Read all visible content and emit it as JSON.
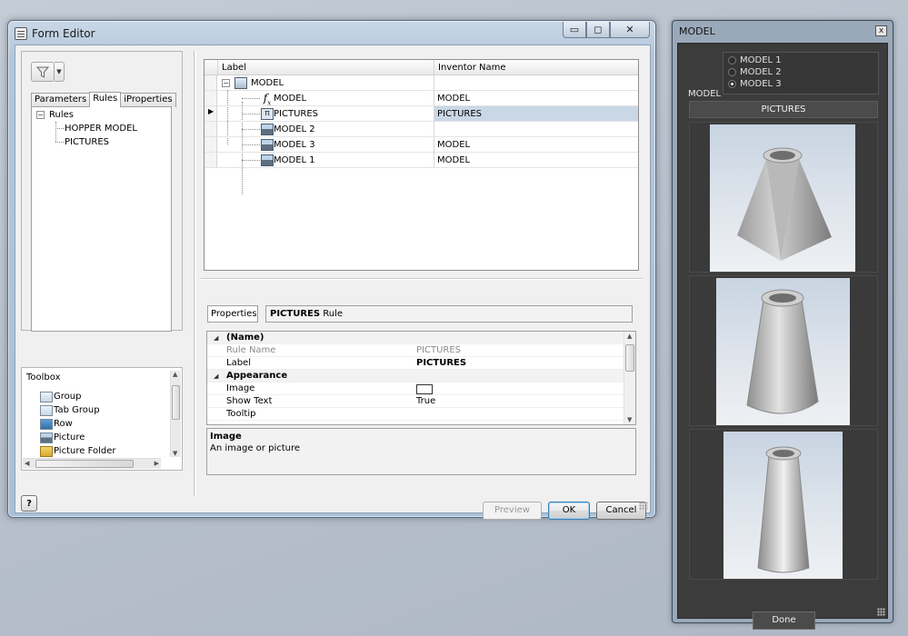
{
  "form_editor": {
    "title": "Form Editor",
    "caption_buttons": {
      "minimize": "▭",
      "maximize": "◻",
      "close": "✕"
    },
    "tabs": [
      "Parameters",
      "Rules",
      "iProperties"
    ],
    "active_tab": "Rules",
    "rules_tree": {
      "root": "Rules",
      "items": [
        "HOPPER MODEL",
        "PICTURES"
      ]
    },
    "toolbox": {
      "title": "Toolbox",
      "items": [
        "Group",
        "Tab Group",
        "Row",
        "Picture",
        "Picture Folder"
      ]
    },
    "grid": {
      "columns": [
        "Label",
        "Inventor Name"
      ],
      "rows": [
        {
          "label": "MODEL",
          "inventor_name": "",
          "icon": "form-root-icon"
        },
        {
          "label": "MODEL",
          "inventor_name": "MODEL",
          "icon": "fx-parameter-icon"
        },
        {
          "label": "PICTURES",
          "inventor_name": "PICTURES",
          "icon": "picture-folder-icon",
          "selected": true
        },
        {
          "label": "MODEL 2",
          "inventor_name": "",
          "icon": "picture-icon"
        },
        {
          "label": "MODEL 3",
          "inventor_name": "MODEL",
          "icon": "picture-icon"
        },
        {
          "label": "MODEL 1",
          "inventor_name": "MODEL",
          "icon": "picture-icon"
        }
      ]
    },
    "properties": {
      "tab": "Properties",
      "header_bold": "PICTURES",
      "header_rest": " Rule",
      "rows": [
        {
          "category": "(Name)"
        },
        {
          "name": "Rule Name",
          "value": "PICTURES",
          "dim": true
        },
        {
          "name": "Label",
          "value": "PICTURES",
          "bold_value": true
        },
        {
          "category": "Appearance"
        },
        {
          "name": "Image",
          "value": ""
        },
        {
          "name": "Show Text",
          "value": "True"
        },
        {
          "name": "Tooltip",
          "value": ""
        }
      ],
      "description_title": "Image",
      "description_text": "An image or picture"
    },
    "buttons": {
      "preview": "Preview",
      "ok": "OK",
      "cancel": "Cancel",
      "help": "?"
    }
  },
  "model_dialog": {
    "title": "MODEL",
    "close": "x",
    "radio_label": "MODEL",
    "options": [
      "MODEL 1",
      "MODEL 2",
      "MODEL 3"
    ],
    "selected": "MODEL 3",
    "pictures_button": "PICTURES",
    "done": "Done"
  }
}
